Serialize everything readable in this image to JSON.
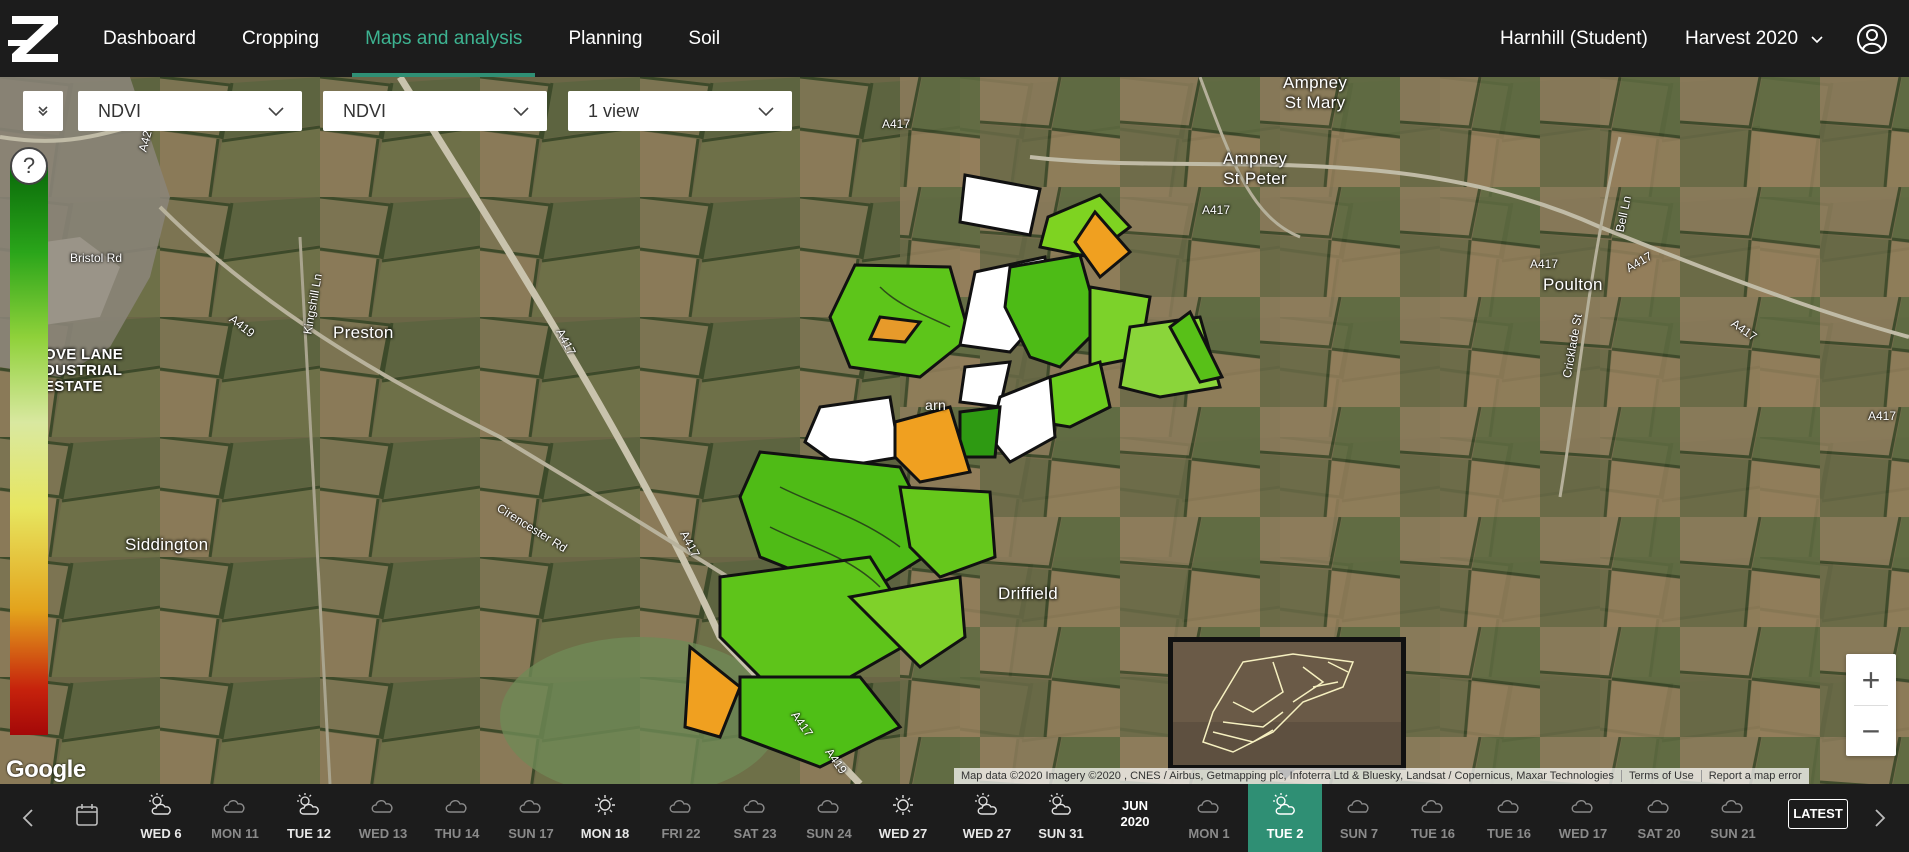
{
  "nav": {
    "items": [
      {
        "label": "Dashboard"
      },
      {
        "label": "Cropping"
      },
      {
        "label": "Maps and analysis"
      },
      {
        "label": "Planning"
      },
      {
        "label": "Soil"
      }
    ],
    "active_index": 2,
    "farm": "Harnhill (Student)",
    "season": "Harvest 2020"
  },
  "controls": {
    "layer_select": "NDVI",
    "index_select": "NDVI",
    "view_select": "1 view",
    "help": "?"
  },
  "map": {
    "place_labels": {
      "ampney_st_mary": "Ampney\nSt Mary",
      "ampney_st_peter": "Ampney\nSt Peter",
      "poulton": "Poulton",
      "preston": "Preston",
      "siddington": "Siddington",
      "driffield": "Driffield",
      "industrial_estate": "OVE LANE\nDUSTRIAL\nESTATE",
      "farm_short": "arn"
    },
    "road_labels": {
      "bristol_rd": "Bristol Rd",
      "a419_west": "A419",
      "a429": "A429",
      "kingshill_ln": "Kingshill Ln",
      "a417_center": "A417",
      "a417_south": "A417",
      "a417_south2": "A417",
      "a419_south": "A419",
      "cirencester_rd": "Cirencester Rd",
      "a417_top": "A417",
      "a417_mid": "A417",
      "a417_east1": "A417",
      "a417_east2": "A417",
      "a417_east3": "A417",
      "a417_edge": "A417",
      "bell_ln": "Bell Ln",
      "cricklade_st": "Cricklade St"
    },
    "google_logo": "Google",
    "attribution": {
      "data": "Map data ©2020 Imagery ©2020 , CNES / Airbus, Getmapping plc, Infoterra Ltd & Bluesky, Landsat / Copernicus, Maxar Technologies",
      "terms": "Terms of Use",
      "report": "Report a map error"
    },
    "zoom_in": "+",
    "zoom_out": "−"
  },
  "timeline": {
    "days": [
      {
        "label": "WED 6",
        "icon": "partly-sunny-icon",
        "bright": true
      },
      {
        "label": "MON 11",
        "icon": "cloud-icon",
        "bright": false
      },
      {
        "label": "TUE 12",
        "icon": "partly-sunny-icon",
        "bright": true
      },
      {
        "label": "WED 13",
        "icon": "cloud-icon",
        "bright": false
      },
      {
        "label": "THU 14",
        "icon": "cloud-icon",
        "bright": false
      },
      {
        "label": "SUN 17",
        "icon": "cloud-icon",
        "bright": false
      },
      {
        "label": "MON 18",
        "icon": "sun-icon",
        "bright": true
      },
      {
        "label": "FRI 22",
        "icon": "cloud-icon",
        "bright": false
      },
      {
        "label": "SAT 23",
        "icon": "cloud-icon",
        "bright": false
      },
      {
        "label": "SUN 24",
        "icon": "cloud-icon",
        "bright": false
      },
      {
        "label": "WED 27",
        "icon": "sun-icon",
        "bright": true
      },
      {
        "label": "WED 27",
        "icon": "partly-sunny-icon",
        "bright": true
      },
      {
        "label": "SUN 31",
        "icon": "partly-sunny-icon",
        "bright": true
      },
      {
        "label": "MON 1",
        "icon": "cloud-icon",
        "bright": false
      },
      {
        "label": "TUE 2",
        "icon": "partly-sunny-icon",
        "bright": true
      },
      {
        "label": "SUN 7",
        "icon": "cloud-icon",
        "bright": false
      },
      {
        "label": "TUE 16",
        "icon": "cloud-icon",
        "bright": false
      },
      {
        "label": "TUE 16",
        "icon": "cloud-icon",
        "bright": false
      },
      {
        "label": "WED 17",
        "icon": "cloud-icon",
        "bright": false
      },
      {
        "label": "SAT 20",
        "icon": "cloud-icon",
        "bright": false
      },
      {
        "label": "SUN 21",
        "icon": "cloud-icon",
        "bright": false
      }
    ],
    "active_index": 14,
    "month_marker": {
      "month": "JUN",
      "year": "2020"
    },
    "latest": "LATEST"
  },
  "colors": {
    "accent": "#2f8f74",
    "accent_text": "#3db391",
    "topbar": "#1c1c1c"
  }
}
